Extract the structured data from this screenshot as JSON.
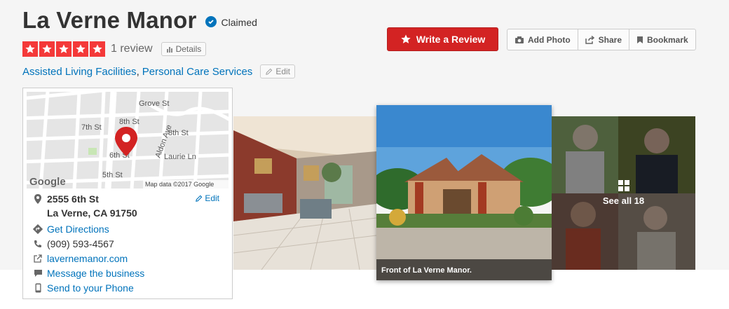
{
  "business": {
    "name": "La Verne Manor",
    "claimed_label": "Claimed",
    "rating_stars": 5,
    "review_count": "1 review",
    "details_label": "Details",
    "categories": [
      "Assisted Living Facilities",
      "Personal Care Services"
    ],
    "edit_label": "Edit"
  },
  "actions": {
    "write_review": "Write a Review",
    "add_photo": "Add Photo",
    "share": "Share",
    "bookmark": "Bookmark"
  },
  "map": {
    "streets": [
      "Grove St",
      "7th St",
      "8th St",
      "8th St",
      "Aldon Ave",
      "Laurie Ln",
      "6th St",
      "5th St"
    ],
    "logo": "Google",
    "attribution": "Map data ©2017 Google"
  },
  "address": {
    "line1": "2555 6th St",
    "line2": "La Verne, CA 91750",
    "edit_label": "Edit",
    "directions": "Get Directions",
    "phone": "(909) 593-4567",
    "website": "lavernemanor.com",
    "message": "Message the business",
    "send_phone": "Send to your Phone"
  },
  "photos": {
    "main_caption": "Front of La Verne Manor.",
    "see_all": "See all 18"
  },
  "colors": {
    "brand_red": "#d32323",
    "star_red": "#f43939",
    "link_blue": "#0073bb"
  }
}
